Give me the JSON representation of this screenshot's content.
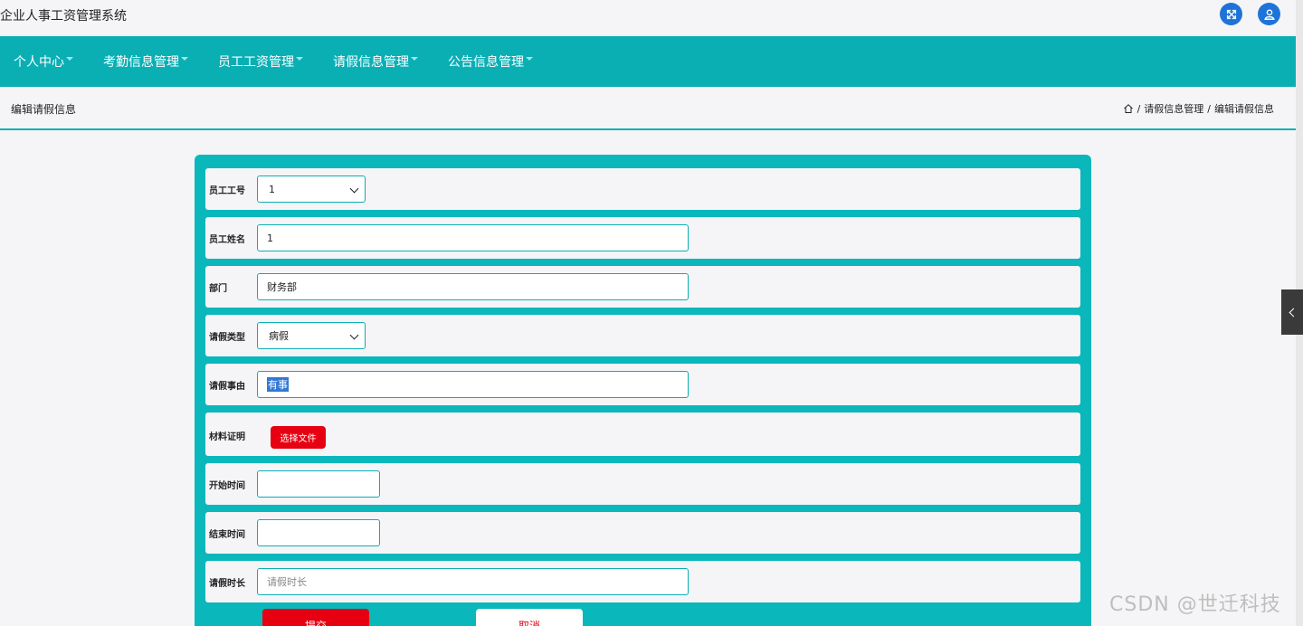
{
  "app": {
    "title": "企业人事工资管理系统"
  },
  "topbar": {
    "fullscreen_icon": "expand-arrows-icon",
    "user_icon": "user-icon",
    "accent": "#1e73d8"
  },
  "nav": {
    "bg_color": "#0aafb4",
    "items": [
      {
        "label": "个人中心"
      },
      {
        "label": "考勤信息管理"
      },
      {
        "label": "员工工资管理"
      },
      {
        "label": "请假信息管理"
      },
      {
        "label": "公告信息管理"
      }
    ]
  },
  "page": {
    "title": "编辑请假信息",
    "breadcrumb": {
      "home_icon": "home-icon",
      "level1": "请假信息管理",
      "level2": "编辑请假信息",
      "sep": "/"
    }
  },
  "form": {
    "fields": {
      "emp_no": {
        "label": "员工工号",
        "value": "1"
      },
      "emp_name": {
        "label": "员工姓名",
        "value": "1"
      },
      "department": {
        "label": "部门",
        "value": "财务部"
      },
      "leave_type": {
        "label": "请假类型",
        "value": "病假"
      },
      "reason": {
        "label": "请假事由",
        "value": "有事"
      },
      "attachment": {
        "label": "材料证明",
        "button": "选择文件"
      },
      "start_time": {
        "label": "开始时间",
        "value": ""
      },
      "end_time": {
        "label": "结束时间",
        "value": ""
      },
      "duration": {
        "label": "请假时长",
        "placeholder": "请假时长"
      }
    },
    "submit_label": "提交",
    "cancel_label": "取消"
  },
  "watermark": "CSDN @世迁科技"
}
